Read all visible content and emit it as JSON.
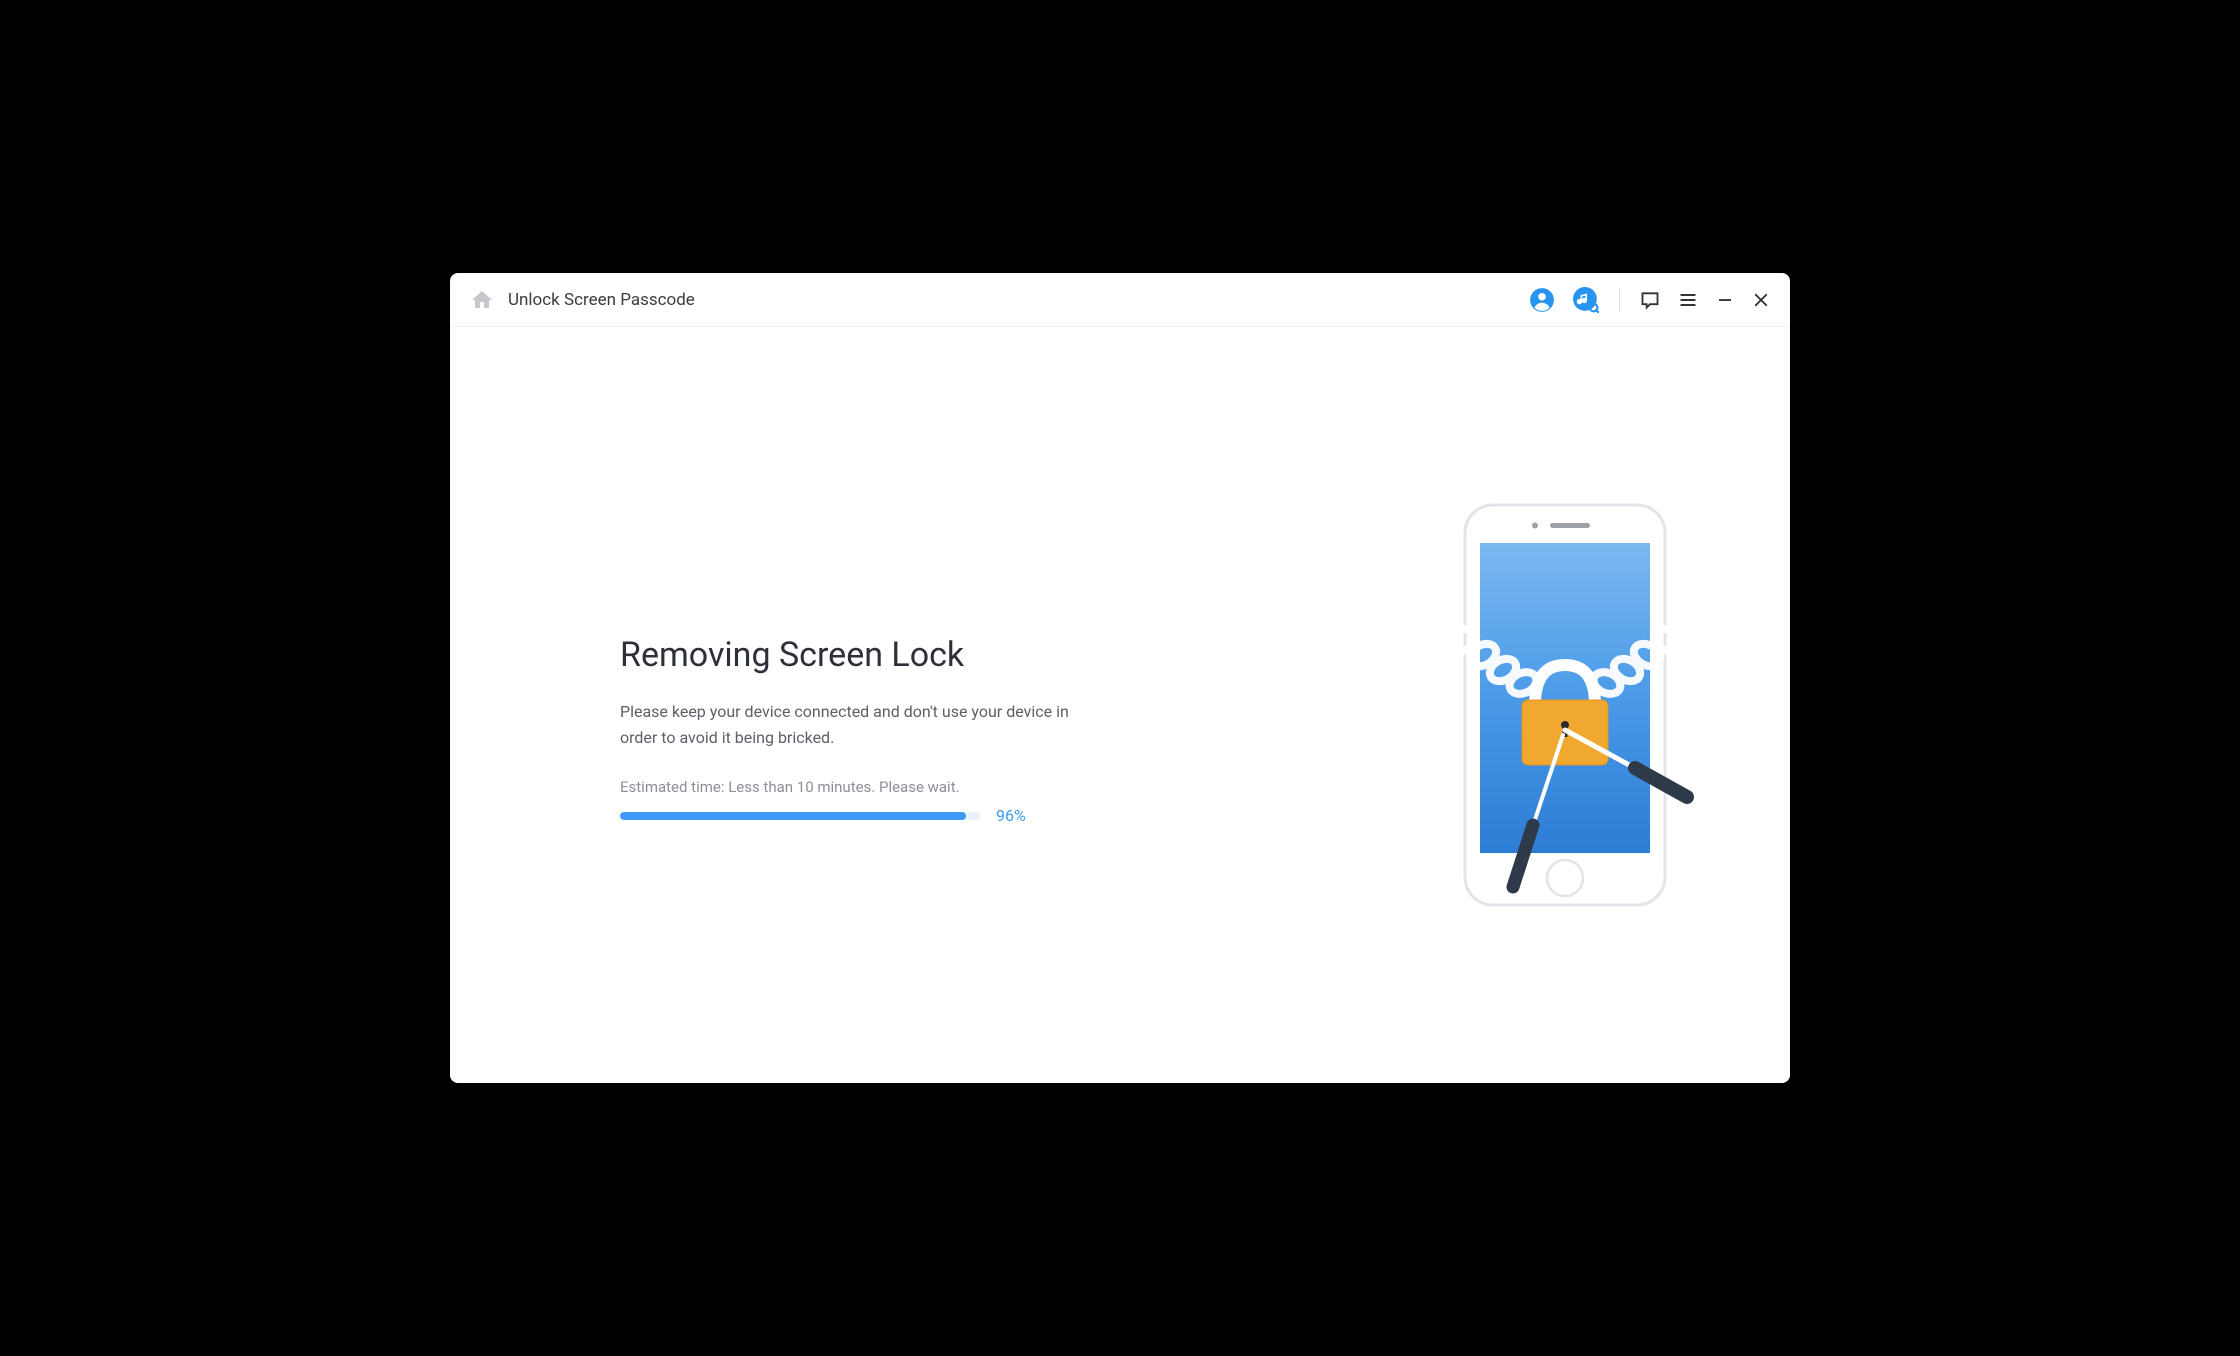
{
  "titlebar": {
    "title": "Unlock Screen Passcode"
  },
  "main": {
    "heading": "Removing Screen Lock",
    "description": "Please keep your device connected and don't use your device in order to avoid it being bricked.",
    "estimated_time": "Estimated time: Less than 10 minutes. Please wait.",
    "progress_percent": 96,
    "progress_label": "96%"
  },
  "colors": {
    "accent": "#3b9af5",
    "blue_icon": "#2694f0"
  }
}
